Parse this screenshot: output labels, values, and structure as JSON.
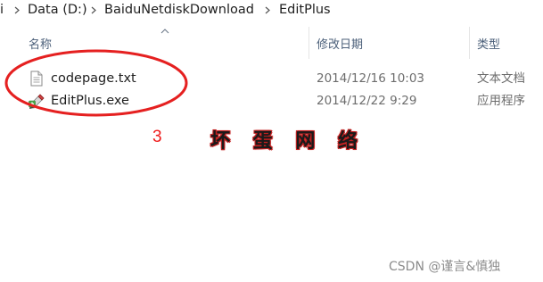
{
  "breadcrumb": {
    "partial_prefix": "i",
    "items": [
      {
        "label": "Data (D:)"
      },
      {
        "label": "BaiduNetdiskDownload"
      },
      {
        "label": "EditPlus"
      }
    ],
    "separator_icon": "chevron-right-icon"
  },
  "columns": {
    "name": "名称",
    "date": "修改日期",
    "type": "类型",
    "sort_icon": "sort-ascending-icon"
  },
  "files": [
    {
      "name": "codepage.txt",
      "date": "2014/12/16 10:03",
      "type": "文本文档",
      "icon": "text-document-icon"
    },
    {
      "name": "EditPlus.exe",
      "date": "2014/12/22 9:29",
      "type": "应用程序",
      "icon": "editplus-app-icon"
    }
  ],
  "annotation": {
    "number": "3",
    "stamp_text": "坏 蛋 网 络",
    "colors": {
      "highlight": "#e52020",
      "stamp_outline": "#c22020"
    }
  },
  "watermark": "CSDN @谨言&慎独",
  "colors": {
    "header_text": "#4c607a",
    "secondary_text": "#6d6d6d",
    "primary_text": "#1e1e1e"
  }
}
